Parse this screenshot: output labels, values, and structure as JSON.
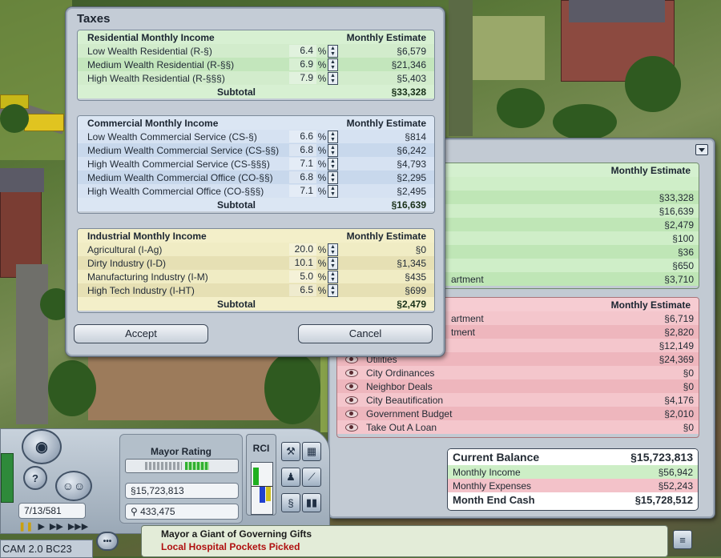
{
  "taxes": {
    "title": "Taxes",
    "residential": {
      "header": "Residential Monthly Income",
      "estimate_header": "Monthly Estimate",
      "rows": [
        {
          "name": "Low Wealth Residential (R-§)",
          "rate": "6.4",
          "pct": "%",
          "estimate": "§6,579"
        },
        {
          "name": "Medium Wealth Residential (R-§§)",
          "rate": "6.9",
          "pct": "%",
          "estimate": "§21,346"
        },
        {
          "name": "High Wealth Residential (R-§§§)",
          "rate": "7.9",
          "pct": "%",
          "estimate": "§5,403"
        }
      ],
      "subtotal_label": "Subtotal",
      "subtotal": "§33,328"
    },
    "commercial": {
      "header": "Commercial Monthly Income",
      "estimate_header": "Monthly Estimate",
      "rows": [
        {
          "name": "Low Wealth Commercial Service (CS-§)",
          "rate": "6.6",
          "pct": "%",
          "estimate": "§814"
        },
        {
          "name": "Medium Wealth Commercial Service (CS-§§)",
          "rate": "6.8",
          "pct": "%",
          "estimate": "§6,242"
        },
        {
          "name": "High Wealth Commercial Service (CS-§§§)",
          "rate": "7.1",
          "pct": "%",
          "estimate": "§4,793"
        },
        {
          "name": "Medium Wealth Commercial Office (CO-§§)",
          "rate": "6.8",
          "pct": "%",
          "estimate": "§2,295"
        },
        {
          "name": "High Wealth Commercial Office (CO-§§§)",
          "rate": "7.1",
          "pct": "%",
          "estimate": "§2,495"
        }
      ],
      "subtotal_label": "Subtotal",
      "subtotal": "§16,639"
    },
    "industrial": {
      "header": "Industrial Monthly Income",
      "estimate_header": "Monthly Estimate",
      "rows": [
        {
          "name": "Agricultural (I-Ag)",
          "rate": "20.0",
          "pct": "%",
          "estimate": "§0"
        },
        {
          "name": "Dirty Industry (I-D)",
          "rate": "10.1",
          "pct": "%",
          "estimate": "§1,345"
        },
        {
          "name": "Manufacturing Industry (I-M)",
          "rate": "5.0",
          "pct": "%",
          "estimate": "§435"
        },
        {
          "name": "High Tech Industry (I-HT)",
          "rate": "6.5",
          "pct": "%",
          "estimate": "§699"
        }
      ],
      "subtotal_label": "Subtotal",
      "subtotal": "§2,479"
    },
    "accept_label": "Accept",
    "cancel_label": "Cancel"
  },
  "budget": {
    "income_header": "Monthly Estimate",
    "income_rows": [
      {
        "label": "",
        "value": ""
      },
      {
        "label": "",
        "value": "§33,328"
      },
      {
        "label": "",
        "value": "§16,639"
      },
      {
        "label": "",
        "value": "§2,479"
      },
      {
        "label": "",
        "value": "§100"
      },
      {
        "label": "",
        "value": "§36"
      },
      {
        "label": "",
        "value": "§650"
      },
      {
        "label": "artment",
        "value": "§3,710"
      }
    ],
    "expense_header": "Monthly Estimate",
    "expense_rows": [
      {
        "label": "artment",
        "value": "§6,719"
      },
      {
        "label": "tment",
        "value": "§2,820"
      },
      {
        "label": "",
        "value": "§12,149"
      },
      {
        "label": "Utilities",
        "value": "§24,369"
      },
      {
        "label": "City Ordinances",
        "value": "§0"
      },
      {
        "label": "Neighbor Deals",
        "value": "§0"
      },
      {
        "label": "City Beautification",
        "value": "§4,176"
      },
      {
        "label": "Government Budget",
        "value": "§2,010"
      },
      {
        "label": "Take Out A Loan",
        "value": "§0"
      }
    ],
    "summary": {
      "current_balance_label": "Current Balance",
      "current_balance": "§15,723,813",
      "monthly_income_label": "Monthly Income",
      "monthly_income": "§56,942",
      "monthly_expenses_label": "Monthly Expenses",
      "monthly_expenses": "§52,243",
      "month_end_cash_label": "Month End Cash",
      "month_end_cash": "§15,728,512"
    }
  },
  "hud": {
    "mayor_rating_label": "Mayor Rating",
    "mayor_rating_level": 0.5,
    "funds": "§15,723,813",
    "population": "433,475",
    "date": "7/13/581",
    "rci_label": "RCI",
    "camera_label": "CAM 2.0 BC23",
    "news": [
      "Mayor a Giant of Governing Gifts",
      "Local Hospital Pockets Picked"
    ],
    "colors": {
      "news_line1": "#1a1a1a",
      "news_line2": "#b01010",
      "rci_r": "#20b020",
      "rci_c": "#2040d0",
      "rci_i": "#d0c020"
    }
  }
}
